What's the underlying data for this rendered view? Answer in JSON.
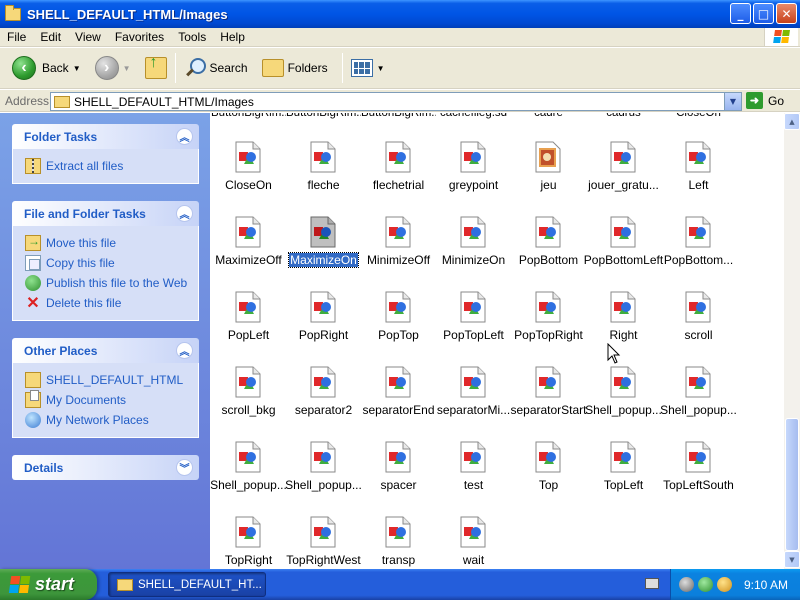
{
  "window": {
    "title": "SHELL_DEFAULT_HTML/Images",
    "buttons": {
      "minimize": "_",
      "maximize": "□",
      "close": "✕"
    }
  },
  "menu": [
    "File",
    "Edit",
    "View",
    "Favorites",
    "Tools",
    "Help"
  ],
  "toolbar": {
    "back_label": "Back",
    "search_label": "Search",
    "folders_label": "Folders"
  },
  "address": {
    "label": "Address",
    "value": "SHELL_DEFAULT_HTML/Images",
    "go_label": "Go"
  },
  "taskpane": {
    "folder_tasks": {
      "title": "Folder Tasks",
      "items": [
        "Extract all files"
      ]
    },
    "file_folder_tasks": {
      "title": "File and Folder Tasks",
      "items": [
        "Move this file",
        "Copy this file",
        "Publish this file to the Web",
        "Delete this file"
      ]
    },
    "other_places": {
      "title": "Other Places",
      "items": [
        "SHELL_DEFAULT_HTML",
        "My Documents",
        "My Network Places"
      ]
    },
    "details": {
      "title": "Details"
    }
  },
  "files": {
    "cut_row": [
      "ButtonBigRim...",
      "ButtonBigRim...",
      "ButtonBigRim...",
      "cachefileg.sd",
      "cadre",
      "cadrus",
      "CloseOn"
    ],
    "rows": [
      [
        "CloseOn",
        "fleche",
        "flechetrial",
        "greypoint",
        "jeu",
        "jouer_gratu...",
        "Left"
      ],
      [
        "MaximizeOff",
        "MaximizeOn",
        "MinimizeOff",
        "MinimizeOn",
        "PopBottom",
        "PopBottomLeft",
        "PopBottom..."
      ],
      [
        "PopLeft",
        "PopRight",
        "PopTop",
        "PopTopLeft",
        "PopTopRight",
        "Right",
        "scroll"
      ],
      [
        "scroll_bkg",
        "separator2",
        "separatorEnd",
        "separatorMi...",
        "separatorStart",
        "Shell_popup...",
        "Shell_popup..."
      ],
      [
        "Shell_popup...",
        "Shell_popup...",
        "spacer",
        "test",
        "Top",
        "TopLeft",
        "TopLeftSouth"
      ],
      [
        "TopRight",
        "TopRightWest",
        "transp",
        "wait"
      ]
    ],
    "selected": "MaximizeOn",
    "special_icon": "jeu"
  },
  "taskbar": {
    "start_label": "start",
    "window_button": "SHELL_DEFAULT_HT...",
    "clock": "9:10 AM"
  },
  "colors": {
    "titlebar": "#0055e5",
    "taskpane_link": "#215dc6",
    "selection": "#316ac5"
  }
}
